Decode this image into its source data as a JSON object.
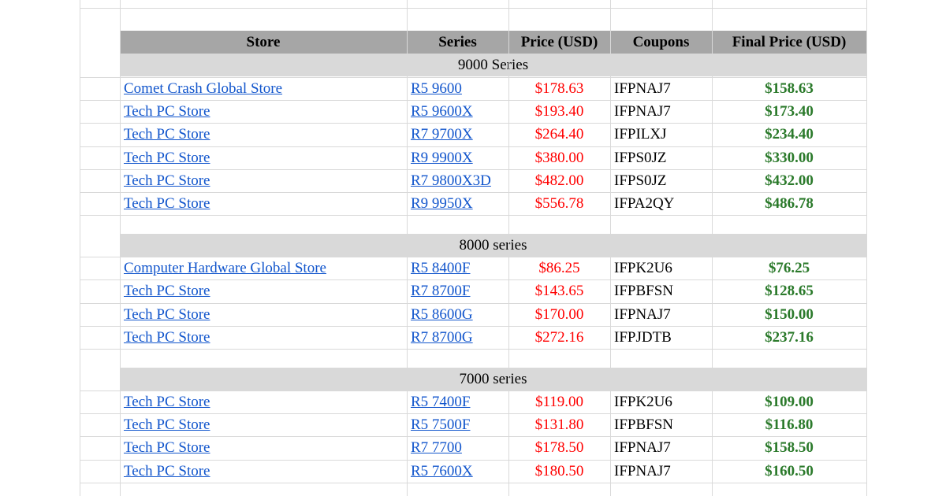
{
  "header": {
    "store": "Store",
    "series": "Series",
    "price": "Price (USD)",
    "coupons": "Coupons",
    "final_price": "Final Price (USD)"
  },
  "sections": [
    {
      "title": "9000 Series",
      "rows": [
        {
          "store": "Comet Crash Global Store",
          "series": "R5 9600",
          "price": "$178.63",
          "coupon": "IFPNAJ7",
          "final": "$158.63"
        },
        {
          "store": "Tech PC Store",
          "series": "R5 9600X",
          "price": "$193.40",
          "coupon": "IFPNAJ7",
          "final": "$173.40"
        },
        {
          "store": "Tech PC Store",
          "series": "R7 9700X",
          "price": "$264.40",
          "coupon": "IFPILXJ",
          "final": "$234.40"
        },
        {
          "store": "Tech PC Store",
          "series": "R9 9900X",
          "price": "$380.00",
          "coupon": "IFPS0JZ",
          "final": "$330.00"
        },
        {
          "store": "Tech PC Store",
          "series": "R7 9800X3D",
          "price": "$482.00",
          "coupon": "IFPS0JZ",
          "final": "$432.00"
        },
        {
          "store": "Tech PC Store",
          "series": "R9 9950X",
          "price": "$556.78",
          "coupon": "IFPA2QY",
          "final": "$486.78"
        }
      ]
    },
    {
      "title": "8000 series",
      "rows": [
        {
          "store": "Computer Hardware Global Store",
          "series": "R5 8400F",
          "price": "$86.25",
          "coupon": "IFPK2U6",
          "final": "$76.25"
        },
        {
          "store": "Tech PC Store",
          "series": "R7 8700F",
          "price": "$143.65",
          "coupon": "IFPBFSN",
          "final": "$128.65"
        },
        {
          "store": "Tech PC Store",
          "series": "R5 8600G",
          "price": "$170.00",
          "coupon": "IFPNAJ7",
          "final": "$150.00"
        },
        {
          "store": "Tech PC Store",
          "series": "R7 8700G",
          "price": "$272.16",
          "coupon": "IFPJDTB",
          "final": "$237.16"
        }
      ]
    },
    {
      "title": "7000 series",
      "rows": [
        {
          "store": "Tech PC Store",
          "series": "R5 7400F",
          "price": "$119.00",
          "coupon": "IFPK2U6",
          "final": "$109.00"
        },
        {
          "store": "Tech PC Store",
          "series": "R5 7500F",
          "price": "$131.80",
          "coupon": "IFPBFSN",
          "final": "$116.80"
        },
        {
          "store": "Tech PC Store",
          "series": "R7 7700",
          "price": "$178.50",
          "coupon": "IFPNAJ7",
          "final": "$158.50"
        },
        {
          "store": "Tech PC Store",
          "series": "R5 7600X",
          "price": "$180.50",
          "coupon": "IFPNAJ7",
          "final": "$160.50"
        }
      ]
    }
  ],
  "colors": {
    "header_bg": "#a6a6a6",
    "section_bg": "#d9d9d9",
    "link": "#1155cc",
    "price": "#ff0000",
    "final_price": "#2b7a2b"
  }
}
